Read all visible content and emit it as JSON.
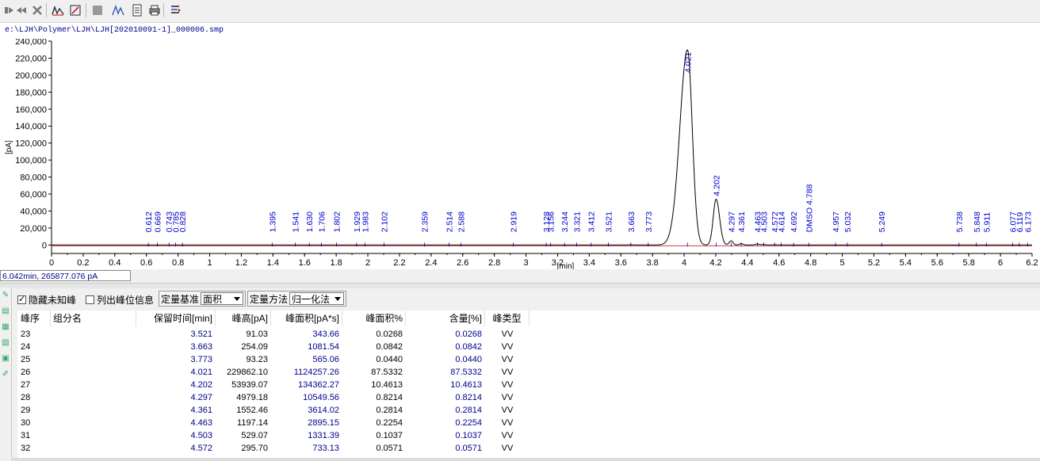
{
  "toolbar": {
    "icons": [
      "stop-icon",
      "forward-icon",
      "delete-icon",
      "baseline-icon",
      "zoom-fit-icon",
      "sheet-icon",
      "peak-icon",
      "report-icon",
      "print-icon",
      "settings-icon"
    ]
  },
  "file_path": "e:\\LJH\\Polymer\\LJH\\LJH[202010091-1]_000006.smp",
  "chart_data": {
    "type": "line",
    "title": "",
    "xlabel": "[min]",
    "ylabel": "[pA]",
    "xlim": [
      0,
      6.2
    ],
    "ylim": [
      -10000,
      240000
    ],
    "x_ticks": [
      "0",
      "0.2",
      "0.4",
      "0.6",
      "0.8",
      "1",
      "1.2",
      "1.4",
      "1.6",
      "1.8",
      "2",
      "2.2",
      "2.4",
      "2.6",
      "2.8",
      "3",
      "3.2",
      "3.4",
      "3.6",
      "3.8",
      "4",
      "4.2",
      "4.4",
      "4.6",
      "4.8",
      "5",
      "5.2",
      "5.4",
      "5.6",
      "5.8",
      "6",
      "6.2"
    ],
    "y_ticks": [
      "240,000",
      "220,000",
      "200,000",
      "180,000",
      "160,000",
      "140,000",
      "120,000",
      "100,000",
      "80,000",
      "60,000",
      "40,000",
      "20,000",
      "0"
    ],
    "peaks": [
      {
        "rt": 3.521,
        "height": 91.03
      },
      {
        "rt": 3.663,
        "height": 254.09
      },
      {
        "rt": 3.773,
        "height": 93.23
      },
      {
        "rt": 4.021,
        "height": 229862.1
      },
      {
        "rt": 4.202,
        "height": 53939.07
      },
      {
        "rt": 4.297,
        "height": 4979.18
      },
      {
        "rt": 4.361,
        "height": 1552.46
      },
      {
        "rt": 4.463,
        "height": 1197.14
      },
      {
        "rt": 4.503,
        "height": 529.07
      },
      {
        "rt": 4.572,
        "height": 295.7
      }
    ],
    "peak_labels": [
      {
        "x": 0.612,
        "text": "0.612"
      },
      {
        "x": 0.669,
        "text": "0.669"
      },
      {
        "x": 0.743,
        "text": "0.743"
      },
      {
        "x": 0.785,
        "text": "0.785"
      },
      {
        "x": 0.828,
        "text": "0.828"
      },
      {
        "x": 1.395,
        "text": "1.395"
      },
      {
        "x": 1.541,
        "text": "1.541"
      },
      {
        "x": 1.63,
        "text": "1.630"
      },
      {
        "x": 1.706,
        "text": "1.706"
      },
      {
        "x": 1.802,
        "text": "1.802"
      },
      {
        "x": 1.929,
        "text": "1.929"
      },
      {
        "x": 1.983,
        "text": "1.983"
      },
      {
        "x": 2.102,
        "text": "2.102"
      },
      {
        "x": 2.359,
        "text": "2.359"
      },
      {
        "x": 2.514,
        "text": "2.514"
      },
      {
        "x": 2.588,
        "text": "2.588"
      },
      {
        "x": 2.919,
        "text": "2.919"
      },
      {
        "x": 3.128,
        "text": "3.128"
      },
      {
        "x": 3.156,
        "text": "3.156"
      },
      {
        "x": 3.244,
        "text": "3.244"
      },
      {
        "x": 3.321,
        "text": "3.321"
      },
      {
        "x": 3.412,
        "text": "3.412"
      },
      {
        "x": 3.521,
        "text": "3.521"
      },
      {
        "x": 3.663,
        "text": "3.663"
      },
      {
        "x": 3.773,
        "text": "3.773"
      },
      {
        "x": 4.021,
        "text": "4.021"
      },
      {
        "x": 4.202,
        "text": "4.202"
      },
      {
        "x": 4.297,
        "text": "4.297"
      },
      {
        "x": 4.361,
        "text": "4.361"
      },
      {
        "x": 4.463,
        "text": "4.463"
      },
      {
        "x": 4.503,
        "text": "4.503"
      },
      {
        "x": 4.572,
        "text": "4.572"
      },
      {
        "x": 4.614,
        "text": "4.614"
      },
      {
        "x": 4.692,
        "text": "4.692"
      },
      {
        "x": 4.788,
        "text": "DMSO 4.788"
      },
      {
        "x": 4.957,
        "text": "4.957"
      },
      {
        "x": 5.032,
        "text": "5.032"
      },
      {
        "x": 5.249,
        "text": "5.249"
      },
      {
        "x": 5.738,
        "text": "5.738"
      },
      {
        "x": 5.848,
        "text": "5.848"
      },
      {
        "x": 5.911,
        "text": "5.911"
      },
      {
        "x": 6.077,
        "text": "6.077"
      },
      {
        "x": 6.119,
        "text": "6.119"
      },
      {
        "x": 6.173,
        "text": "6.173"
      }
    ]
  },
  "cursor_readout": "6.042min, 265877.076 pA",
  "controls": {
    "hide_unknown_label": "隐藏未知峰",
    "hide_unknown_checked": true,
    "show_window_label": "列出峰位信息",
    "show_window_checked": false,
    "quant_basis_label": "定量基准",
    "quant_basis_value": "面积",
    "quant_method_label": "定量方法",
    "quant_method_value": "归一化法"
  },
  "table": {
    "headers": [
      "峰序",
      "组分名",
      "保留时间[min]",
      "峰高[pA]",
      "峰面积[pA*s]",
      "峰面积%",
      "含量[%]",
      "峰类型"
    ],
    "rows": [
      [
        "23",
        "",
        "3.521",
        "91.03",
        "343.66",
        "0.0268",
        "0.0268",
        "VV"
      ],
      [
        "24",
        "",
        "3.663",
        "254.09",
        "1081.54",
        "0.0842",
        "0.0842",
        "VV"
      ],
      [
        "25",
        "",
        "3.773",
        "93.23",
        "565.06",
        "0.0440",
        "0.0440",
        "VV"
      ],
      [
        "26",
        "",
        "4.021",
        "229862.10",
        "1124257.26",
        "87.5332",
        "87.5332",
        "VV"
      ],
      [
        "27",
        "",
        "4.202",
        "53939.07",
        "134362.27",
        "10.4613",
        "10.4613",
        "VV"
      ],
      [
        "28",
        "",
        "4.297",
        "4979.18",
        "10549.56",
        "0.8214",
        "0.8214",
        "VV"
      ],
      [
        "29",
        "",
        "4.361",
        "1552.46",
        "3614.02",
        "0.2814",
        "0.2814",
        "VV"
      ],
      [
        "30",
        "",
        "4.463",
        "1197.14",
        "2895.15",
        "0.2254",
        "0.2254",
        "VV"
      ],
      [
        "31",
        "",
        "4.503",
        "529.07",
        "1331.39",
        "0.1037",
        "0.1037",
        "VV"
      ],
      [
        "32",
        "",
        "4.572",
        "295.70",
        "733.13",
        "0.0571",
        "0.0571",
        "VV"
      ]
    ]
  },
  "colors": {
    "trace": "#000000",
    "peak_label": "#0000cd",
    "baseline": "#c00000",
    "data_blue": "#00008b"
  }
}
